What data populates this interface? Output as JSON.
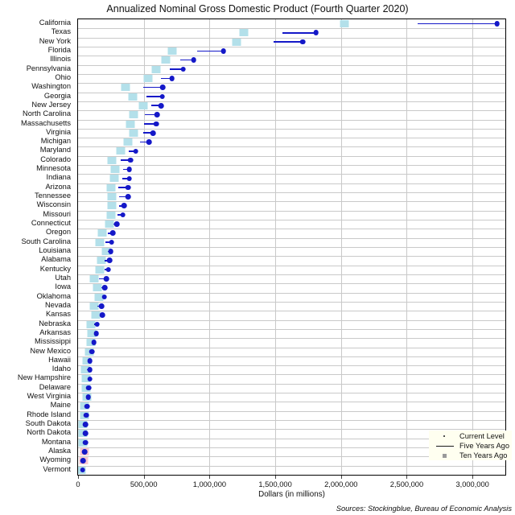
{
  "chart_data": {
    "type": "bar",
    "title": "Annualized Nominal Gross Domestic Product (Fourth Quarter 2020)",
    "xlabel": "Dollars (in millions)",
    "ylabel": "",
    "xlim": [
      0,
      3250000
    ],
    "xticks": [
      0,
      500000,
      1000000,
      1500000,
      2000000,
      2500000,
      3000000
    ],
    "xticklabels": [
      "0",
      "500,000",
      "1,000,000",
      "1,500,000",
      "2,000,000",
      "2,500,000",
      "3,000,000"
    ],
    "grid": true,
    "legend_position": "bottom-right",
    "source": "Sources: Stockingblue, Bureau of Economic Analysis",
    "series": [
      {
        "name": "Current Level",
        "key": "current",
        "marker": "dot",
        "color": "#1418c8"
      },
      {
        "name": "Five Years Ago",
        "key": "five",
        "marker": "line",
        "color": "#1418c8"
      },
      {
        "name": "Ten Years Ago",
        "key": "ten",
        "marker": "square",
        "color": "#b3e0ea",
        "color_down": "#f9c8cf"
      }
    ],
    "categories": [
      "California",
      "Texas",
      "New York",
      "Florida",
      "Illinois",
      "Pennsylvania",
      "Ohio",
      "Washington",
      "Georgia",
      "New Jersey",
      "North Carolina",
      "Massachusetts",
      "Virginia",
      "Michigan",
      "Maryland",
      "Colorado",
      "Minnesota",
      "Indiana",
      "Arizona",
      "Tennessee",
      "Wisconsin",
      "Missouri",
      "Connecticut",
      "Oregon",
      "South Carolina",
      "Louisiana",
      "Alabama",
      "Kentucky",
      "Utah",
      "Iowa",
      "Oklahoma",
      "Nevada",
      "Kansas",
      "Nebraska",
      "Arkansas",
      "Mississippi",
      "New Mexico",
      "Hawaii",
      "Idaho",
      "New Hampshire",
      "Delaware",
      "West Virginia",
      "Maine",
      "Rhode Island",
      "South Dakota",
      "North Dakota",
      "Montana",
      "Alaska",
      "Wyoming",
      "Vermont"
    ],
    "rows": [
      {
        "state": "California",
        "current": 3186000,
        "five": 2585000,
        "ten": 2025000
      },
      {
        "state": "Texas",
        "current": 1810000,
        "five": 1555000,
        "ten": 1260000
      },
      {
        "state": "New York",
        "current": 1710000,
        "five": 1490000,
        "ten": 1205000
      },
      {
        "state": "Florida",
        "current": 1105000,
        "five": 905000,
        "ten": 715000
      },
      {
        "state": "Illinois",
        "current": 880000,
        "five": 775000,
        "ten": 670000
      },
      {
        "state": "Pennsylvania",
        "current": 800000,
        "five": 700000,
        "ten": 595000
      },
      {
        "state": "Ohio",
        "current": 715000,
        "five": 630000,
        "ten": 535000
      },
      {
        "state": "Washington",
        "current": 645000,
        "five": 495000,
        "ten": 360000
      },
      {
        "state": "Georgia",
        "current": 640000,
        "five": 520000,
        "ten": 415000
      },
      {
        "state": "New Jersey",
        "current": 630000,
        "five": 555000,
        "ten": 495000
      },
      {
        "state": "North Carolina",
        "current": 600000,
        "five": 510000,
        "ten": 425000
      },
      {
        "state": "Massachusetts",
        "current": 595000,
        "five": 500000,
        "ten": 400000
      },
      {
        "state": "Virginia",
        "current": 570000,
        "five": 495000,
        "ten": 425000
      },
      {
        "state": "Michigan",
        "current": 540000,
        "five": 470000,
        "ten": 380000
      },
      {
        "state": "Maryland",
        "current": 440000,
        "five": 385000,
        "ten": 325000
      },
      {
        "state": "Colorado",
        "current": 400000,
        "five": 325000,
        "ten": 255000
      },
      {
        "state": "Minnesota",
        "current": 390000,
        "five": 340000,
        "ten": 280000
      },
      {
        "state": "Indiana",
        "current": 390000,
        "five": 335000,
        "ten": 275000
      },
      {
        "state": "Arizona",
        "current": 380000,
        "five": 305000,
        "ten": 250000
      },
      {
        "state": "Tennessee",
        "current": 380000,
        "five": 315000,
        "ten": 255000
      },
      {
        "state": "Wisconsin",
        "current": 350000,
        "five": 315000,
        "ten": 260000
      },
      {
        "state": "Missouri",
        "current": 340000,
        "five": 300000,
        "ten": 250000
      },
      {
        "state": "Connecticut",
        "current": 295000,
        "five": 270000,
        "ten": 240000
      },
      {
        "state": "Oregon",
        "current": 265000,
        "five": 225000,
        "ten": 185000
      },
      {
        "state": "South Carolina",
        "current": 255000,
        "five": 210000,
        "ten": 165000
      },
      {
        "state": "Louisiana",
        "current": 250000,
        "five": 225000,
        "ten": 215000
      },
      {
        "state": "Alabama",
        "current": 240000,
        "five": 200000,
        "ten": 175000
      },
      {
        "state": "Kentucky",
        "current": 230000,
        "five": 200000,
        "ten": 165000
      },
      {
        "state": "Utah",
        "current": 215000,
        "five": 160000,
        "ten": 120000
      },
      {
        "state": "Iowa",
        "current": 205000,
        "five": 180000,
        "ten": 145000
      },
      {
        "state": "Oklahoma",
        "current": 200000,
        "five": 190000,
        "ten": 160000
      },
      {
        "state": "Nevada",
        "current": 180000,
        "five": 145000,
        "ten": 125000
      },
      {
        "state": "Kansas",
        "current": 185000,
        "five": 165000,
        "ten": 135000
      },
      {
        "state": "Nebraska",
        "current": 145000,
        "five": 125000,
        "ten": 100000
      },
      {
        "state": "Arkansas",
        "current": 140000,
        "five": 125000,
        "ten": 105000
      },
      {
        "state": "Mississippi",
        "current": 120000,
        "five": 110000,
        "ten": 95000
      },
      {
        "state": "New Mexico",
        "current": 105000,
        "five": 95000,
        "ten": 85000
      },
      {
        "state": "Hawaii",
        "current": 90000,
        "five": 85000,
        "ten": 70000
      },
      {
        "state": "Idaho",
        "current": 90000,
        "five": 70000,
        "ten": 55000
      },
      {
        "state": "New Hampshire",
        "current": 90000,
        "five": 78000,
        "ten": 62000
      },
      {
        "state": "Delaware",
        "current": 80000,
        "five": 70000,
        "ten": 62000
      },
      {
        "state": "West Virginia",
        "current": 78000,
        "five": 72000,
        "ten": 65000
      },
      {
        "state": "Maine",
        "current": 70000,
        "five": 60000,
        "ten": 50000
      },
      {
        "state": "Rhode Island",
        "current": 62000,
        "five": 55000,
        "ten": 48000
      },
      {
        "state": "South Dakota",
        "current": 58000,
        "five": 48000,
        "ten": 38000
      },
      {
        "state": "North Dakota",
        "current": 58000,
        "five": 52000,
        "ten": 35000
      },
      {
        "state": "Montana",
        "current": 55000,
        "five": 45000,
        "ten": 36000
      },
      {
        "state": "Alaska",
        "current": 50000,
        "five": 50000,
        "ten": 52000
      },
      {
        "state": "Wyoming",
        "current": 38000,
        "five": 38000,
        "ten": 41000
      },
      {
        "state": "Vermont",
        "current": 34000,
        "five": 30000,
        "ten": 26000
      }
    ]
  }
}
